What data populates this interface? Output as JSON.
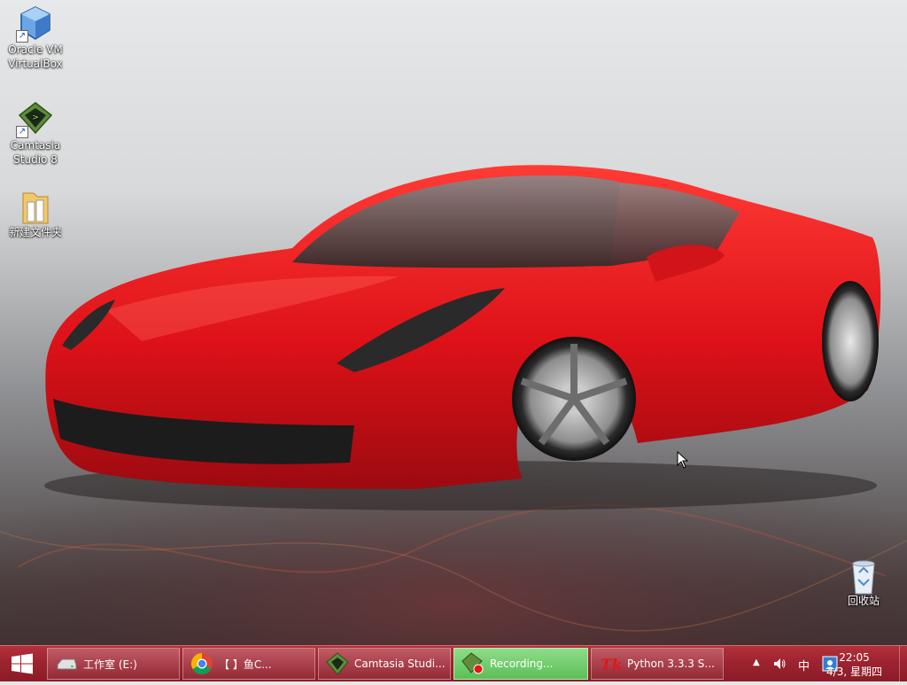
{
  "desktop": {
    "icons": [
      {
        "label": "Oracle VM\nVirtualBox",
        "icon": "virtualbox-icon"
      },
      {
        "label": "Camtasia\nStudio 8",
        "icon": "camtasia-icon"
      },
      {
        "label": "新建文件夹",
        "icon": "folder-icon"
      },
      {
        "label": "回收站",
        "icon": "recycle-bin-icon"
      }
    ]
  },
  "taskbar": {
    "tasks": [
      {
        "label": "工作室 (E:)",
        "icon": "drive-icon"
      },
      {
        "label": "【      】鱼C...",
        "icon": "chrome-icon"
      },
      {
        "label": "Camtasia Studi...",
        "icon": "camtasia-icon"
      },
      {
        "label": "Recording...",
        "icon": "recording-icon"
      },
      {
        "label": "Python 3.3.3 S...",
        "icon": "tk-icon"
      }
    ],
    "tray": {
      "ime": "中",
      "time": "22:05",
      "date": "4/3, 星期四"
    }
  },
  "colors": {
    "taskbar": "#9e2330",
    "active_task": "#5bbf57",
    "car_red": "#e0151b"
  }
}
